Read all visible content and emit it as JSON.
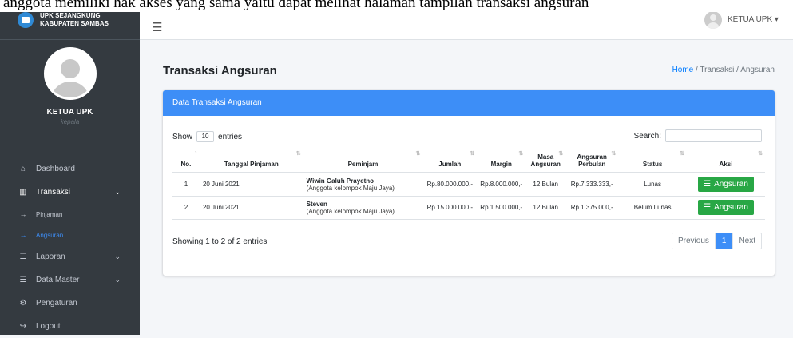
{
  "caption": "anggota memiliki hak akses yang sama yaitu dapat melihat halaman tampilan transaksi angsuran",
  "brand": {
    "line1": "UPK SEJANGKUNG",
    "line2": "KABUPATEN SAMBAS"
  },
  "user": {
    "name": "KETUA UPK",
    "role": "kepala"
  },
  "sidebar": {
    "items": [
      {
        "label": "Dashboard",
        "icon": "home-icon",
        "glyph": "⌂"
      },
      {
        "label": "Transaksi",
        "icon": "columns-icon",
        "glyph": "▥",
        "chevron": "⌄"
      },
      {
        "label": "Pinjaman",
        "icon": "arrow-right-icon",
        "glyph": "→"
      },
      {
        "label": "Angsuran",
        "icon": "arrow-right-icon",
        "glyph": "→"
      },
      {
        "label": "Laporan",
        "icon": "list-icon",
        "glyph": "☰",
        "chevron": "⌄"
      },
      {
        "label": "Data Master",
        "icon": "list-icon",
        "glyph": "☰",
        "chevron": "⌄"
      },
      {
        "label": "Pengaturan",
        "icon": "gear-icon",
        "glyph": "⚙"
      },
      {
        "label": "Logout",
        "icon": "logout-icon",
        "glyph": "↪"
      }
    ]
  },
  "topbar": {
    "menu_glyph": "☰",
    "user_label": "KETUA UPK ▾"
  },
  "page": {
    "title": "Transaksi Angsuran",
    "breadcrumb": {
      "home": "Home",
      "sep": " / ",
      "section": "Transaksi",
      "current": "Angsuran"
    }
  },
  "card": {
    "header": "Data Transaksi Angsuran",
    "show_label": "Show",
    "page_size": "10",
    "entries_label": "entries",
    "search_label": "Search:",
    "columns": [
      "No.",
      "Tanggal Pinjaman",
      "Peminjam",
      "Jumlah",
      "Margin",
      "Masa Angsuran",
      "Angsuran Perbulan",
      "Status",
      "Aksi"
    ],
    "rows": [
      {
        "no": "1",
        "date": "20 Juni 2021",
        "name": "Wiwin Galuh Prayetno",
        "group": "(Anggota kelompok Maju Jaya)",
        "jumlah": "Rp.80.000.000,-",
        "margin": "Rp.8.000.000,-",
        "masa": "12 Bulan",
        "perbulan": "Rp.7.333.333,-",
        "status": "Lunas",
        "action": "Angsuran"
      },
      {
        "no": "2",
        "date": "20 Juni 2021",
        "name": "Steven",
        "group": "(Anggota kelompok Maju Jaya)",
        "jumlah": "Rp.15.000.000,-",
        "margin": "Rp.1.500.000,-",
        "masa": "12 Bulan",
        "perbulan": "Rp.1.375.000,-",
        "status": "Belum Lunas",
        "action": "Angsuran"
      }
    ],
    "showing": "Showing 1 to 2 of 2 entries",
    "pager": {
      "prev": "Previous",
      "page": "1",
      "next": "Next"
    }
  }
}
